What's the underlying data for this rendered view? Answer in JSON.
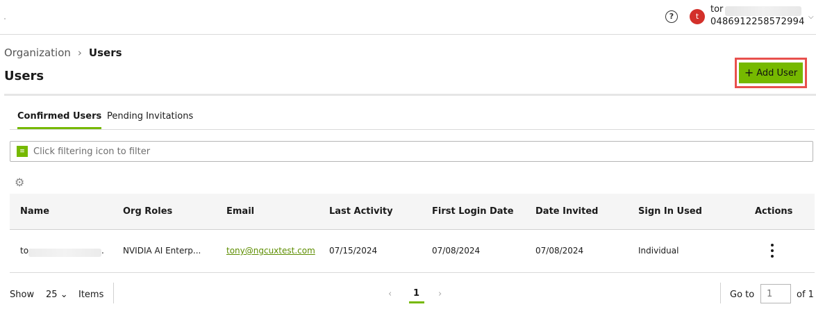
{
  "header": {
    "help_icon": "question-circle-icon",
    "user": {
      "avatar_letter": "t",
      "name": "tor",
      "org_id": "0486912258572994",
      "avatar_color": "#d3302a"
    }
  },
  "breadcrumb": {
    "parent": "Organization",
    "separator": "›",
    "current": "Users"
  },
  "page_title": "Users",
  "actions": {
    "add_user_label": "Add User",
    "add_user_icon": "+",
    "accent_color": "#76b900",
    "highlight_color": "#e8504d"
  },
  "tabs": [
    {
      "label": "Confirmed Users",
      "active": true
    },
    {
      "label": "Pending Invitations",
      "active": false
    }
  ],
  "filter": {
    "placeholder": "Click filtering icon to filter",
    "icon": "filter-icon"
  },
  "table": {
    "columns": [
      "Name",
      "Org Roles",
      "Email",
      "Last Activity",
      "First Login Date",
      "Date Invited",
      "Sign In Used",
      "Actions"
    ],
    "rows": [
      {
        "name": "to",
        "name_suffix": ".",
        "org_roles": "NVIDIA AI Enterp...",
        "email": "tony@ngcuxtest.com",
        "last_activity": "07/15/2024",
        "first_login_date": "07/08/2024",
        "date_invited": "07/08/2024",
        "sign_in_used": "Individual"
      }
    ]
  },
  "pagination": {
    "show_label": "Show",
    "page_size": "25",
    "items_label": "Items",
    "prev": "‹",
    "current_page": "1",
    "next": "›",
    "goto_label": "Go to",
    "goto_placeholder": "1",
    "of_label": "of 1"
  }
}
